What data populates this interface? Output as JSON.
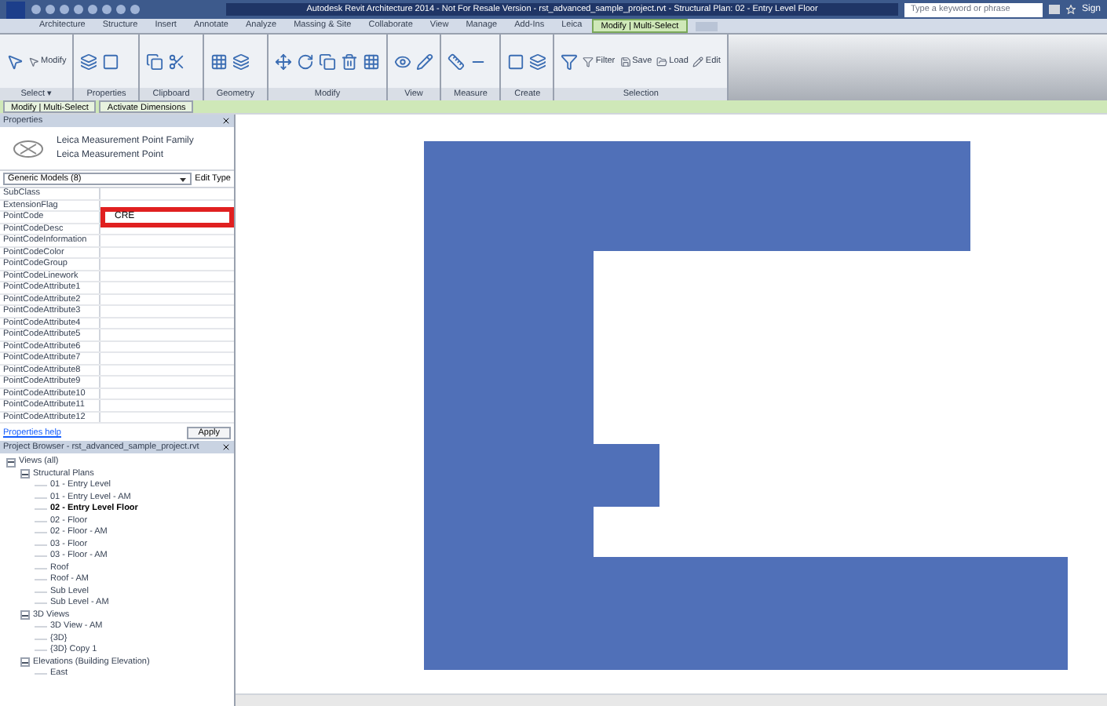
{
  "title_bar": {
    "title": "Autodesk Revit Architecture 2014 - Not For Resale Version - rst_advanced_sample_project.rvt - Structural Plan: 02 - Entry Level Floor",
    "search": {
      "placeholder": "Type a keyword or phrase"
    },
    "sign_in": "Sign"
  },
  "ribbon_tabs": [
    {
      "label": "Architecture",
      "selected": false
    },
    {
      "label": "Structure",
      "selected": false
    },
    {
      "label": "Insert",
      "selected": false
    },
    {
      "label": "Annotate",
      "selected": false
    },
    {
      "label": "Analyze",
      "selected": false
    },
    {
      "label": "Massing & Site",
      "selected": false
    },
    {
      "label": "Collaborate",
      "selected": false
    },
    {
      "label": "View",
      "selected": false
    },
    {
      "label": "Manage",
      "selected": false
    },
    {
      "label": "Add-Ins",
      "selected": false
    },
    {
      "label": "Leica",
      "selected": false
    },
    {
      "label": "Modify | Multi-Select",
      "selected": true
    }
  ],
  "ribbon_panels": [
    {
      "label": "Select ▾",
      "buttons": [
        "Modify"
      ]
    },
    {
      "label": "Properties"
    },
    {
      "label": "Clipboard"
    },
    {
      "label": "Geometry"
    },
    {
      "label": "Modify"
    },
    {
      "label": "View"
    },
    {
      "label": "Measure"
    },
    {
      "label": "Create"
    },
    {
      "label": "Selection",
      "buttons": [
        "Filter",
        "Save",
        "Load",
        "Edit"
      ]
    }
  ],
  "context_bar": [
    {
      "label": "Modify | Multi-Select",
      "selected": false
    },
    {
      "label": "Activate Dimensions",
      "selected": false
    }
  ],
  "properties": {
    "header": "Properties",
    "type_name": "Leica Measurement Point Family",
    "type_subname": "Leica Measurement Point",
    "category": "Generic Models (8)",
    "edit_type": "Edit Type",
    "rows": [
      {
        "name": "SubClass"
      },
      {
        "name": "ExtensionFlag"
      },
      {
        "name": "PointCode",
        "value": "CRE",
        "editing": true
      },
      {
        "name": "PointCodeDesc"
      },
      {
        "name": "PointCodeInformation"
      },
      {
        "name": "PointCodeColor"
      },
      {
        "name": "PointCodeGroup"
      },
      {
        "name": "PointCodeLinework"
      },
      {
        "name": "PointCodeAttribute1"
      },
      {
        "name": "PointCodeAttribute2"
      },
      {
        "name": "PointCodeAttribute3"
      },
      {
        "name": "PointCodeAttribute4"
      },
      {
        "name": "PointCodeAttribute5"
      },
      {
        "name": "PointCodeAttribute6"
      },
      {
        "name": "PointCodeAttribute7"
      },
      {
        "name": "PointCodeAttribute8"
      },
      {
        "name": "PointCodeAttribute9"
      },
      {
        "name": "PointCodeAttribute10"
      },
      {
        "name": "PointCodeAttribute11"
      },
      {
        "name": "PointCodeAttribute12"
      }
    ],
    "help_link": "Properties help",
    "apply": "Apply"
  },
  "project_browser": {
    "header": "Project Browser - rst_advanced_sample_project.rvt",
    "tree": [
      {
        "label": "Views (all)",
        "expanded": true,
        "selected": false,
        "children": [
          {
            "label": "Structural Plans",
            "expanded": true,
            "selected": false,
            "children": [
              {
                "label": "01 - Entry Level",
                "selected": false
              },
              {
                "label": "01 - Entry Level - AM",
                "selected": false
              },
              {
                "label": "02 - Entry Level Floor",
                "selected": true
              },
              {
                "label": "02 - Floor",
                "selected": false
              },
              {
                "label": "02 - Floor - AM",
                "selected": false
              },
              {
                "label": "03 - Floor",
                "selected": false
              },
              {
                "label": "03 - Floor - AM",
                "selected": false
              },
              {
                "label": "Roof",
                "selected": false
              },
              {
                "label": "Roof - AM",
                "selected": false
              },
              {
                "label": "Sub Level",
                "selected": false
              },
              {
                "label": "Sub Level - AM",
                "selected": false
              }
            ]
          },
          {
            "label": "3D Views",
            "expanded": true,
            "selected": false,
            "children": [
              {
                "label": "3D View - AM",
                "selected": false
              },
              {
                "label": "{3D}",
                "selected": false
              },
              {
                "label": "{3D} Copy 1",
                "selected": false
              }
            ]
          },
          {
            "label": "Elevations (Building Elevation)",
            "expanded": true,
            "selected": false,
            "children": [
              {
                "label": "East",
                "selected": false
              }
            ]
          }
        ]
      }
    ]
  }
}
